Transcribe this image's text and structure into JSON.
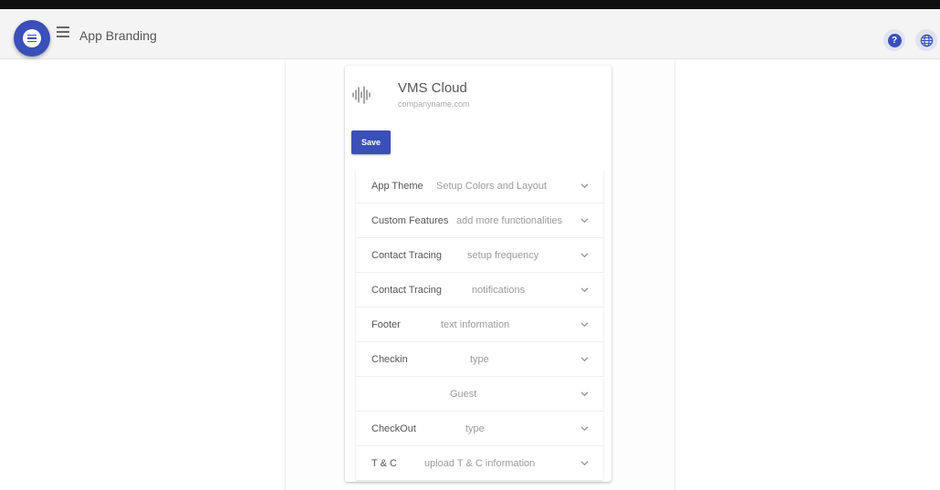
{
  "header": {
    "title": "App Branding",
    "fab_icon": "chat-bubble-icon",
    "menu_icon": "hamburger-menu-icon",
    "help_icon": "help-icon",
    "help_glyph": "?",
    "language_icon": "globe-icon"
  },
  "brand": {
    "name": "VMS Cloud",
    "url": "companyname.com",
    "logo_icon": "sound-wave-logo"
  },
  "actions": {
    "save_label": "Save"
  },
  "sections": [
    {
      "title": "App Theme",
      "description": "Setup Colors and Layout"
    },
    {
      "title": "Custom Features",
      "description": "add more functionalities"
    },
    {
      "title": "Contact Tracing",
      "description": "setup frequency"
    },
    {
      "title": "Contact Tracing",
      "description": "notifications"
    },
    {
      "title": "Footer",
      "description": "text information"
    },
    {
      "title": "Checkin",
      "description": "type"
    },
    {
      "title": "",
      "description": "Guest"
    },
    {
      "title": "CheckOut",
      "description": "type"
    },
    {
      "title": "T & C",
      "description": "upload T & C information"
    }
  ],
  "colors": {
    "primary": "#3a4fb8",
    "appbar_bg": "#f4f4f4",
    "top_strip": "#0f0f0f"
  }
}
